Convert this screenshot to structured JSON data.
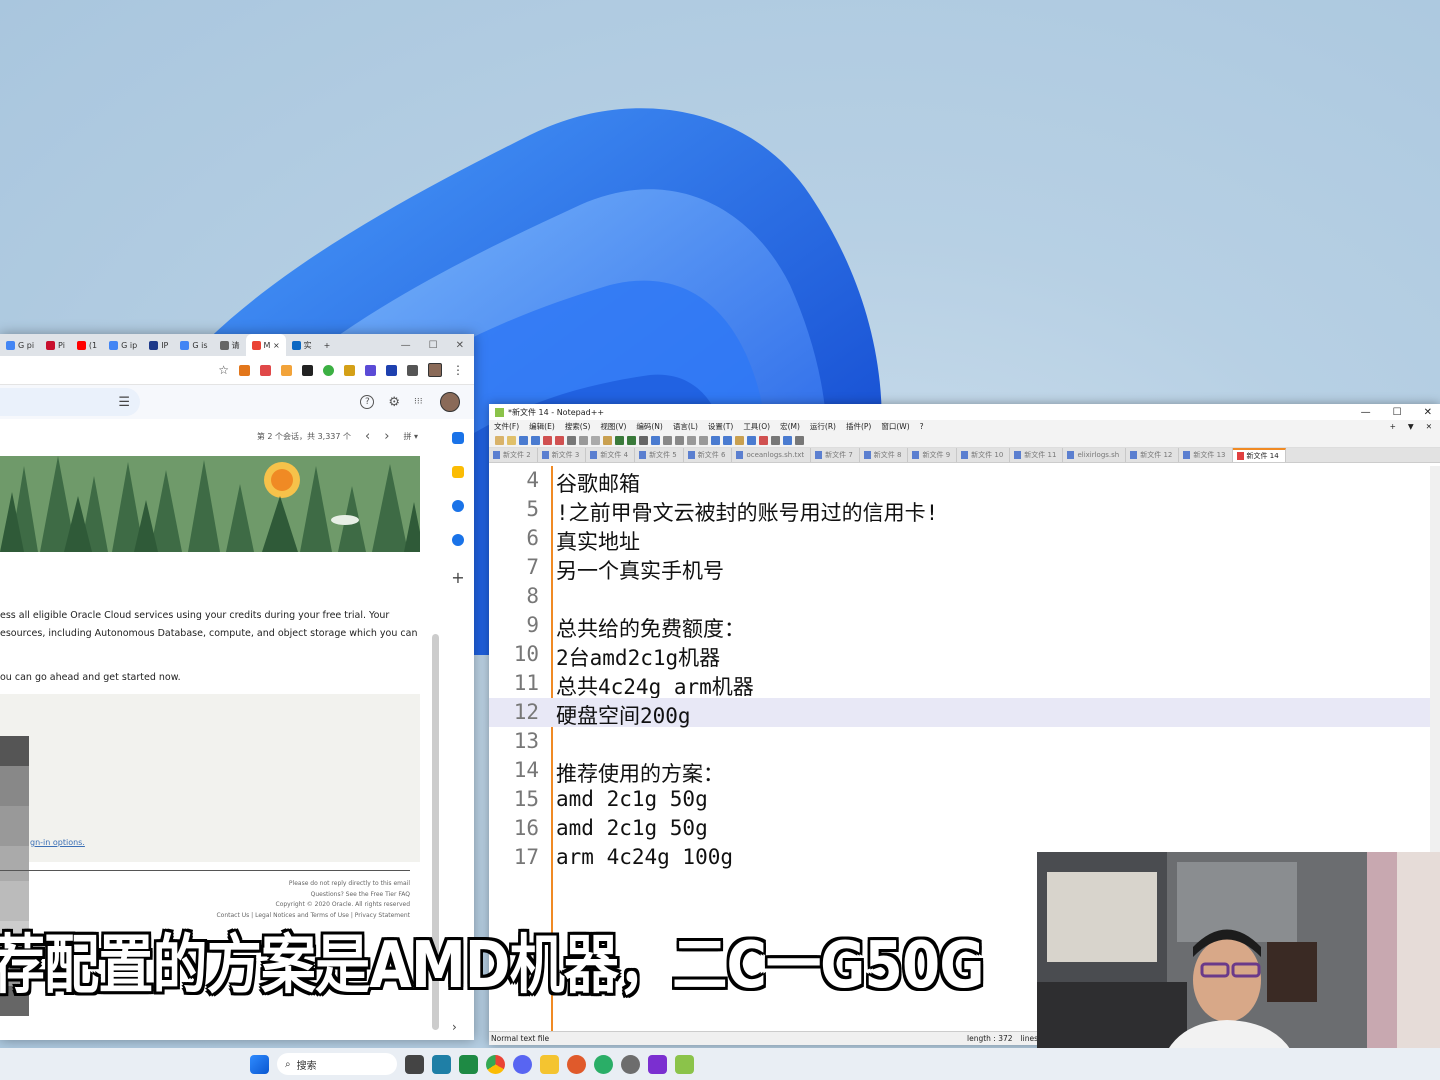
{
  "chrome": {
    "tabs": [
      {
        "label": "G pi",
        "color": "#4285f4"
      },
      {
        "label": "Pi",
        "color": "#c8102e"
      },
      {
        "label": "(1",
        "color": "#ff0000"
      },
      {
        "label": "G ip",
        "color": "#4285f4"
      },
      {
        "label": "IP",
        "color": "#1e3a8a"
      },
      {
        "label": "G is",
        "color": "#4285f4"
      },
      {
        "label": "请",
        "color": "#666666"
      },
      {
        "label": "M ×",
        "color": "#ea4335",
        "active": true
      },
      {
        "label": "实",
        "color": "#0a66c2"
      }
    ],
    "new_tab": "+",
    "window_buttons": {
      "minimize": "—",
      "maximize": "☐",
      "close": "✕"
    },
    "star": "☆",
    "more": "⋮"
  },
  "gmail": {
    "filter_icon": "⚙",
    "help_icon": "?",
    "settings_icon": "⚙",
    "apps_icon": "⋮⋮⋮",
    "pager_text": "第 2 个会话，共 3,337 个",
    "prev": "‹",
    "next": "›",
    "input_tool": "拼 ▾",
    "body_lines": [
      "ess all eligible Oracle Cloud services using your credits during your free trial. Your",
      "esources, including Autonomous Database, compute, and object storage which you can",
      "ou can go ahead and get started now."
    ],
    "signin_link": "gn-in options.",
    "footer": [
      "Please do not reply directly to this email",
      "Questions? See the Free Tier FAQ",
      "Copyright © 2020 Oracle. All rights reserved",
      "Contact Us | Legal Notices and Terms of Use | Privacy Statement"
    ],
    "rail_add": "+",
    "expand": "›"
  },
  "npp": {
    "title": "*新文件 14 - Notepad++",
    "menu": [
      "文件(F)",
      "编辑(E)",
      "搜索(S)",
      "视图(V)",
      "编码(N)",
      "语言(L)",
      "设置(T)",
      "工具(O)",
      "宏(M)",
      "运行(R)",
      "插件(P)",
      "窗口(W)",
      "?"
    ],
    "tabs": [
      "新文件 2",
      "新文件 3",
      "新文件 4",
      "新文件 5",
      "新文件 6",
      "oceanlogs.sh.txt",
      "新文件 7",
      "新文件 8",
      "新文件 9",
      "新文件 10",
      "新文件 11",
      "elixirlogs.sh",
      "新文件 12",
      "新文件 13",
      "新文件 14"
    ],
    "lines": [
      {
        "n": "4",
        "text": "谷歌邮箱"
      },
      {
        "n": "5",
        "text": "!之前甲骨文云被封的账号用过的信用卡!"
      },
      {
        "n": "6",
        "text": "真实地址"
      },
      {
        "n": "7",
        "text": "另一个真实手机号"
      },
      {
        "n": "8",
        "text": ""
      },
      {
        "n": "9",
        "text": "总共给的免费额度："
      },
      {
        "n": "10",
        "text": "2台amd2c1g机器"
      },
      {
        "n": "11",
        "text": "总共4c24g arm机器"
      },
      {
        "n": "12",
        "text": "硬盘空间200g",
        "highlight": true
      },
      {
        "n": "13",
        "text": ""
      },
      {
        "n": "14",
        "text": "推荐使用的方案："
      },
      {
        "n": "15",
        "text": "amd 2c1g 50g"
      },
      {
        "n": "16",
        "text": "amd 2c1g 50g"
      },
      {
        "n": "17",
        "text": "arm 4c24g 100g"
      }
    ],
    "status_left": "Normal text file",
    "status_length": "length : 372",
    "status_lines": "lines"
  },
  "subtitle": "荐配置的方案是AMD机器，二C一G50G",
  "taskbar": {
    "search_placeholder": "搜索"
  }
}
